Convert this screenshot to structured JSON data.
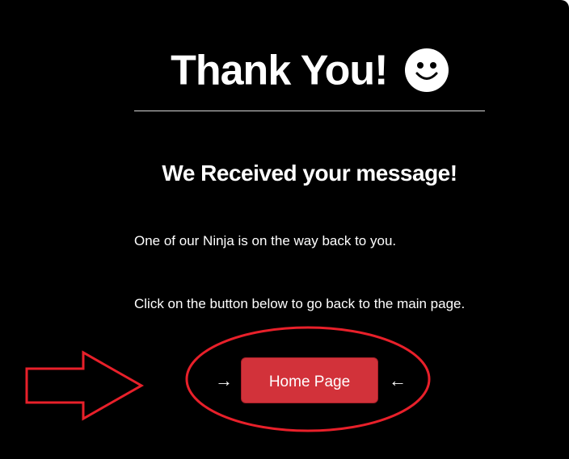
{
  "page": {
    "title": "Thank You!",
    "subtitle": "We Received your message!",
    "paragraph_1": "One of our Ninja is on the way back to you.",
    "paragraph_2": "Click on the button below to go back to the main page."
  },
  "button": {
    "label": "Home Page",
    "left_arrow": "→",
    "right_arrow": "←",
    "color": "#d2323a"
  },
  "icons": {
    "title_icon": "smiley-face-icon",
    "annotation_arrow": "big-arrow-pointing-right-icon",
    "annotation_ellipse": "highlight-ellipse"
  },
  "colors": {
    "background": "#000000",
    "text": "#ffffff",
    "annotation": "#e8202a"
  }
}
